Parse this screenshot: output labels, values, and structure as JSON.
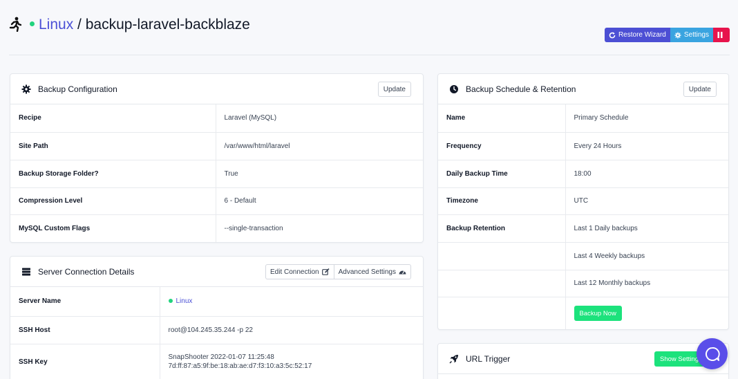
{
  "header": {
    "server_name": "Linux",
    "separator": "/",
    "backup_name": "backup-laravel-backblaze",
    "restore_wizard_label": "Restore Wizard",
    "settings_label": "Settings"
  },
  "backup_config": {
    "title": "Backup Configuration",
    "update_label": "Update",
    "rows": [
      {
        "key": "Recipe",
        "value": "Laravel (MySQL)"
      },
      {
        "key": "Site Path",
        "value": "/var/www/html/laravel"
      },
      {
        "key": "Backup Storage Folder?",
        "value": "True"
      },
      {
        "key": "Compression Level",
        "value": "6 - Default"
      },
      {
        "key": "MySQL Custom Flags",
        "value": "--single-transaction"
      }
    ]
  },
  "server_connection": {
    "title": "Server Connection Details",
    "edit_label": "Edit Connection",
    "advanced_label": "Advanced Settings",
    "rows": [
      {
        "key": "Server Name",
        "value": "Linux"
      },
      {
        "key": "SSH Host",
        "value": "root@104.245.35.244 -p 22"
      },
      {
        "key": "SSH Key",
        "value": "SnapShooter 2022-01-07 11:25:48",
        "value2": "7d:ff:87:a5:9f:be:18:ab:ae:d7:f3:10:a3:5c:52:17"
      }
    ]
  },
  "schedule": {
    "title": "Backup Schedule & Retention",
    "update_label": "Update",
    "rows": [
      {
        "key": "Name",
        "value": "Primary Schedule"
      },
      {
        "key": "Frequency",
        "value": "Every 24 Hours"
      },
      {
        "key": "Daily Backup Time",
        "value": "18:00"
      },
      {
        "key": "Timezone",
        "value": "UTC"
      },
      {
        "key": "Backup Retention",
        "value": "Last 1 Daily backups"
      },
      {
        "key": "",
        "value": "Last 4 Weekly backups"
      },
      {
        "key": "",
        "value": "Last 12 Monthly backups"
      }
    ],
    "backup_now_label": "Backup Now"
  },
  "url_trigger": {
    "title": "URL Trigger",
    "show_settings_label": "Show Settings"
  },
  "colors": {
    "accent": "#4c4fd4",
    "settings": "#3aa4e0",
    "pause": "#e7144c",
    "green": "#1ce27c",
    "status_online": "#22d37e",
    "chat": "#5a4ee9"
  }
}
